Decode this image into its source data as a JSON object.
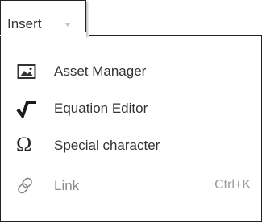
{
  "tab": {
    "label": "Insert",
    "caret_icon": "caret-down-icon"
  },
  "menu": {
    "items": [
      {
        "label": "Asset Manager",
        "icon": "image-icon",
        "shortcut": "",
        "disabled": false
      },
      {
        "label": "Equation Editor",
        "icon": "sqrt-icon",
        "shortcut": "",
        "disabled": false
      },
      {
        "label": "Special character",
        "icon": "omega-icon",
        "glyph": "Ω",
        "shortcut": "",
        "disabled": false
      },
      {
        "label": "Link",
        "icon": "link-icon",
        "shortcut": "Ctrl+K",
        "disabled": true
      }
    ]
  },
  "colors": {
    "border": "#222222",
    "text": "#333333",
    "muted": "#9a9a9a",
    "caret": "#c4c4c4"
  }
}
